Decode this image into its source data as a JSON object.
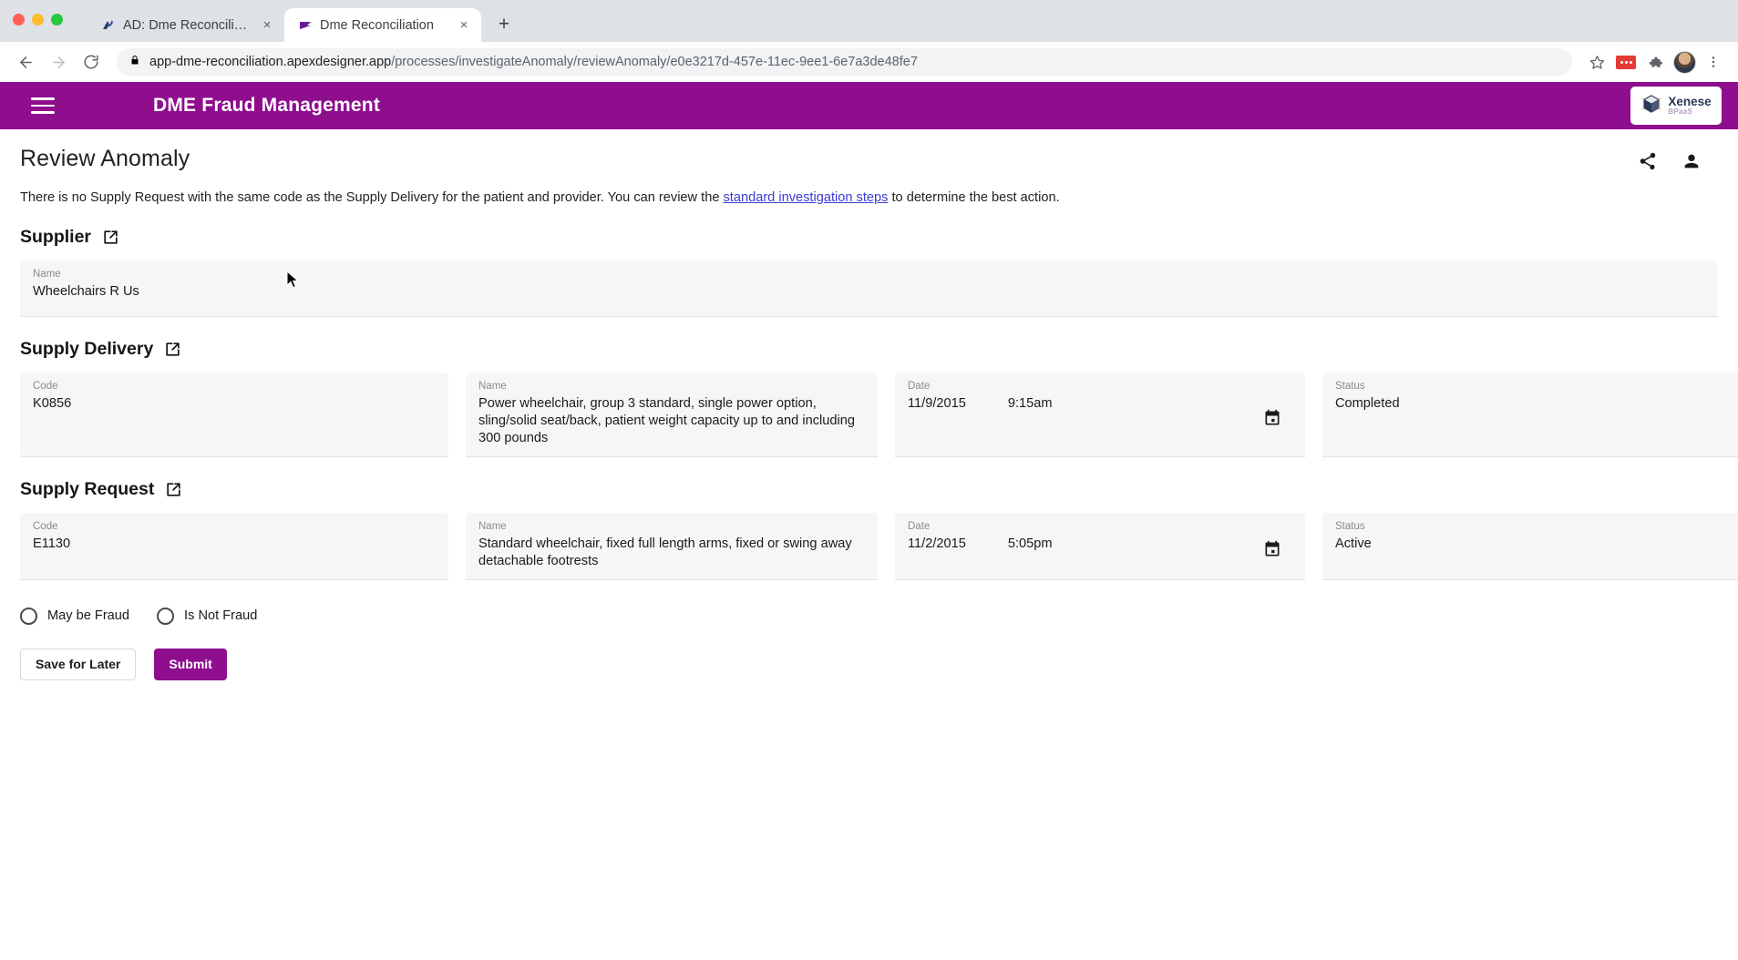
{
  "browser": {
    "tabs": [
      {
        "title": "AD: Dme Reconciliation",
        "favicon": "apexdesigner-icon",
        "active": false,
        "close_label": "×"
      },
      {
        "title": "Dme Reconciliation",
        "favicon": "flag-icon",
        "active": true,
        "close_label": "×"
      }
    ],
    "new_tab_label": "+",
    "nav": {
      "back": "←",
      "forward": "→",
      "reload": "⟳"
    },
    "omnibox": {
      "lock_icon": "lock-icon",
      "host": "app-dme-reconciliation.apexdesigner.app",
      "path": "/processes/investigateAnomaly/reviewAnomaly/e0e3217d-457e-11ec-9ee1-6e7a3de48fe7"
    },
    "toolbar_icons": [
      "bookmark-star-icon",
      "extension-red-icon",
      "extensions-puzzle-icon",
      "profile-avatar",
      "chrome-menu-icon"
    ]
  },
  "header": {
    "menu_icon": "hamburger-menu-icon",
    "title": "DME Fraud Management",
    "brand": {
      "name": "Xenese",
      "sub": "BPaaS",
      "icon": "cube-logo-icon"
    },
    "background_color": "#8e0e8e"
  },
  "page": {
    "title": "Review Anomaly",
    "actions": [
      {
        "name": "share-icon",
        "label": "Share"
      },
      {
        "name": "account-icon",
        "label": "Account"
      }
    ],
    "intro": {
      "before": "There is no Supply Request with the same code as the Supply Delivery for the patient and provider. You can review the ",
      "link": "standard investigation steps",
      "after": " to determine the best action."
    }
  },
  "sections": [
    {
      "title": "Supplier",
      "link_icon": "open-in-new-icon",
      "fields": [
        {
          "label": "Name",
          "value": "Wheelchairs R Us"
        }
      ]
    },
    {
      "title": "Supply Delivery",
      "link_icon": "open-in-new-icon",
      "fields": [
        {
          "label": "Code",
          "value": "K0856"
        },
        {
          "label": "Name",
          "value": "Power wheelchair, group 3 standard, single power option, sling/solid seat/back, patient weight capacity up to and including 300 pounds"
        },
        {
          "label": "Date",
          "value": "11/9/2015",
          "time": "9:15am",
          "icon": "calendar-icon"
        },
        {
          "label": "Status",
          "value": "Completed"
        }
      ]
    },
    {
      "title": "Supply Request",
      "link_icon": "open-in-new-icon",
      "fields": [
        {
          "label": "Code",
          "value": "E1130"
        },
        {
          "label": "Name",
          "value": "Standard wheelchair, fixed full length arms, fixed or swing away detachable footrests"
        },
        {
          "label": "Date",
          "value": "11/2/2015",
          "time": "5:05pm",
          "icon": "calendar-icon"
        },
        {
          "label": "Status",
          "value": "Active"
        }
      ]
    }
  ],
  "decision": {
    "options": [
      {
        "label": "May be Fraud",
        "selected": false
      },
      {
        "label": "Is Not Fraud",
        "selected": false
      }
    ]
  },
  "buttons": {
    "save_label": "Save for Later",
    "submit_label": "Submit",
    "primary_color": "#8e0e8e"
  }
}
